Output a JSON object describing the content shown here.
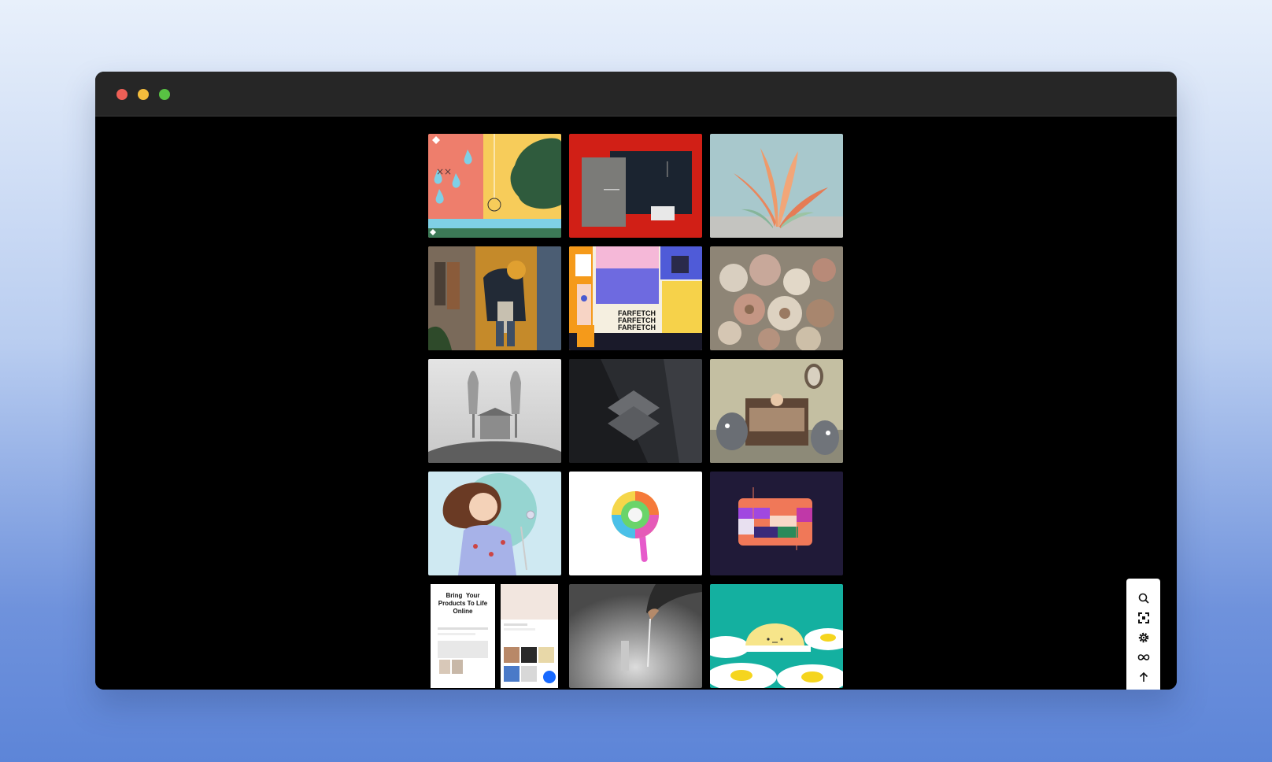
{
  "window": {
    "controls": {
      "close_color": "#ee5f56",
      "minimize_color": "#f4bd3c",
      "maximize_color": "#58c243"
    }
  },
  "gallery": {
    "tiles": [
      {
        "subject": "abstract-raindrops-illustration"
      },
      {
        "subject": "stationery-brand-mockup"
      },
      {
        "subject": "aloe-plant-render"
      },
      {
        "subject": "man-in-closet-illustration"
      },
      {
        "subject": "farfetch-poster-collage",
        "text": "FARFETCH"
      },
      {
        "subject": "dried-flowers-arrangement"
      },
      {
        "subject": "foggy-house-photo"
      },
      {
        "subject": "dark-card-mockup"
      },
      {
        "subject": "bedroom-creatures-illustration"
      },
      {
        "subject": "girl-with-wand-illustration"
      },
      {
        "subject": "lollipop-3d-render"
      },
      {
        "subject": "colorful-card-graphic"
      },
      {
        "subject": "website-landing-pages",
        "headline_1": "Bring",
        "headline_2": "Your",
        "headline_3": "Products To Life",
        "headline_4": "Online"
      },
      {
        "subject": "hand-with-pen-photo"
      },
      {
        "subject": "egg-sun-illustration"
      }
    ]
  },
  "toolbar": {
    "tools": [
      {
        "icon": "search-icon"
      },
      {
        "icon": "fullscreen-icon"
      },
      {
        "icon": "settings-gear-icon"
      },
      {
        "icon": "infinite-scroll-icon"
      },
      {
        "icon": "arrow-up-icon"
      },
      {
        "icon": "github-icon"
      }
    ]
  },
  "close_button": {
    "icon": "close-icon"
  }
}
